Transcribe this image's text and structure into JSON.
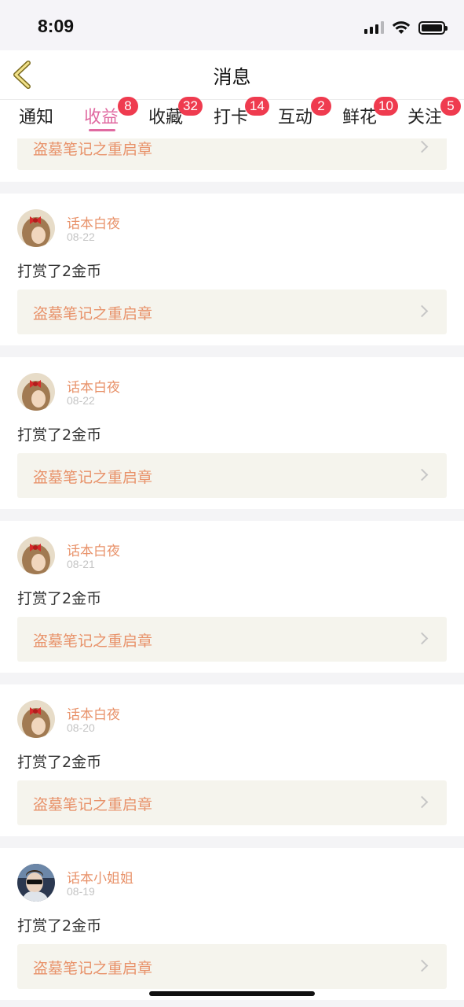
{
  "status_bar": {
    "time": "8:09"
  },
  "header": {
    "title": "消息"
  },
  "tabs": [
    {
      "label": "通知",
      "badge": ""
    },
    {
      "label": "收益",
      "badge": "8"
    },
    {
      "label": "收藏",
      "badge": "32"
    },
    {
      "label": "打卡",
      "badge": "14"
    },
    {
      "label": "互动",
      "badge": "2"
    },
    {
      "label": "鲜花",
      "badge": "10"
    },
    {
      "label": "关注",
      "badge": "5"
    }
  ],
  "active_tab": "收益",
  "colors": {
    "accent": "#e06aa1",
    "badge": "#ef3b4f",
    "link_text": "#e8926a",
    "link_bg": "#f5f4ed"
  },
  "partial_card": {
    "book_title": "盗墓笔记之重启章"
  },
  "cards": [
    {
      "user": "话本白夜",
      "date": "08-22",
      "message": "打赏了2金币",
      "book_title": "盗墓笔记之重启章",
      "avatar": "girl-red-bow"
    },
    {
      "user": "话本白夜",
      "date": "08-22",
      "message": "打赏了2金币",
      "book_title": "盗墓笔记之重启章",
      "avatar": "girl-red-bow"
    },
    {
      "user": "话本白夜",
      "date": "08-21",
      "message": "打赏了2金币",
      "book_title": "盗墓笔记之重启章",
      "avatar": "girl-red-bow"
    },
    {
      "user": "话本白夜",
      "date": "08-20",
      "message": "打赏了2金币",
      "book_title": "盗墓笔记之重启章",
      "avatar": "girl-red-bow"
    },
    {
      "user": "话本小姐姐",
      "date": "08-19",
      "message": "打赏了2金币",
      "book_title": "盗墓笔记之重启章",
      "avatar": "person-sunglasses"
    }
  ]
}
